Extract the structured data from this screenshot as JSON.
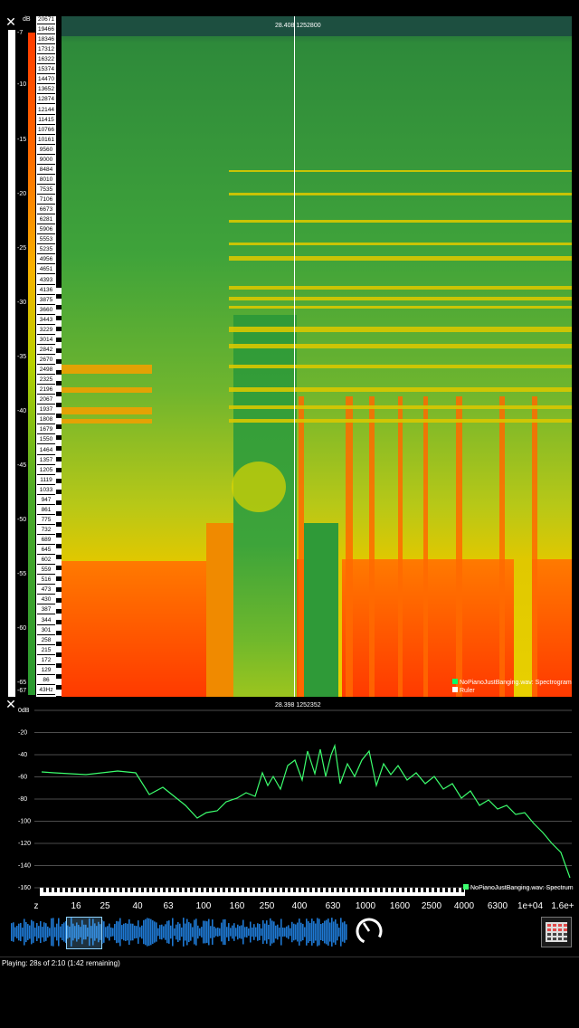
{
  "spectrogram": {
    "readout": "28.408 1252800",
    "db_unit": "dB",
    "db_labels": [
      "-7",
      "-10",
      "-15",
      "-20",
      "-25",
      "-30",
      "-35",
      "-40",
      "-45",
      "-50",
      "-55",
      "-60",
      "-65",
      "-67"
    ],
    "freq_labels": [
      "20671",
      "19466",
      "18346",
      "17312",
      "16322",
      "15374",
      "14470",
      "13652",
      "12874",
      "12144",
      "11415",
      "10766",
      "10161",
      "9560",
      "9000",
      "8484",
      "8010",
      "7535",
      "7106",
      "6673",
      "6281",
      "5906",
      "5553",
      "5235",
      "4956",
      "4651",
      "4393",
      "4136",
      "3875",
      "3660",
      "3443",
      "3229",
      "3014",
      "2842",
      "2670",
      "2498",
      "2325",
      "2196",
      "2067",
      "1937",
      "1808",
      "1679",
      "1550",
      "1464",
      "1357",
      "1205",
      "1119",
      "1033",
      "947",
      "861",
      "775",
      "732",
      "689",
      "645",
      "602",
      "559",
      "516",
      "473",
      "430",
      "387",
      "344",
      "301",
      "258",
      "215",
      "172",
      "129",
      "86",
      "43Hz"
    ],
    "legend": {
      "series": "NoPianoJustBanging.wav: Spectrogram",
      "ruler": "Ruler",
      "series_color": "#00ff66",
      "ruler_color": "#ffffff"
    },
    "cursor_time_s": 28.408
  },
  "spectrum": {
    "readout": "28.398 1252352",
    "db_labels": [
      "0dB",
      "-20",
      "-40",
      "-60",
      "-80",
      "-100",
      "-120",
      "-140",
      "-160"
    ],
    "freq_labels": [
      "z",
      "16",
      "25",
      "40",
      "63",
      "100",
      "160",
      "250",
      "400",
      "630",
      "1000",
      "1600",
      "2500",
      "4000",
      "6300",
      "1e+04",
      "1.6e+"
    ],
    "legend": "NoPianoJustBanging.wav: Spectrum",
    "line_color": "#3cff6e"
  },
  "transport": {
    "waveform_color": "#1e78d2",
    "playhead_color": "#8fd3ff",
    "volume_knob": "volume-knob-icon",
    "grid_button": "grid-icon"
  },
  "status": {
    "text": "Playing: 28s of 2:10 (1:42 remaining)"
  },
  "colors": {
    "spectrogram_low": "#2a9a30",
    "spectrogram_mid": "#c8d400",
    "spectrogram_high": "#ff3b00"
  }
}
